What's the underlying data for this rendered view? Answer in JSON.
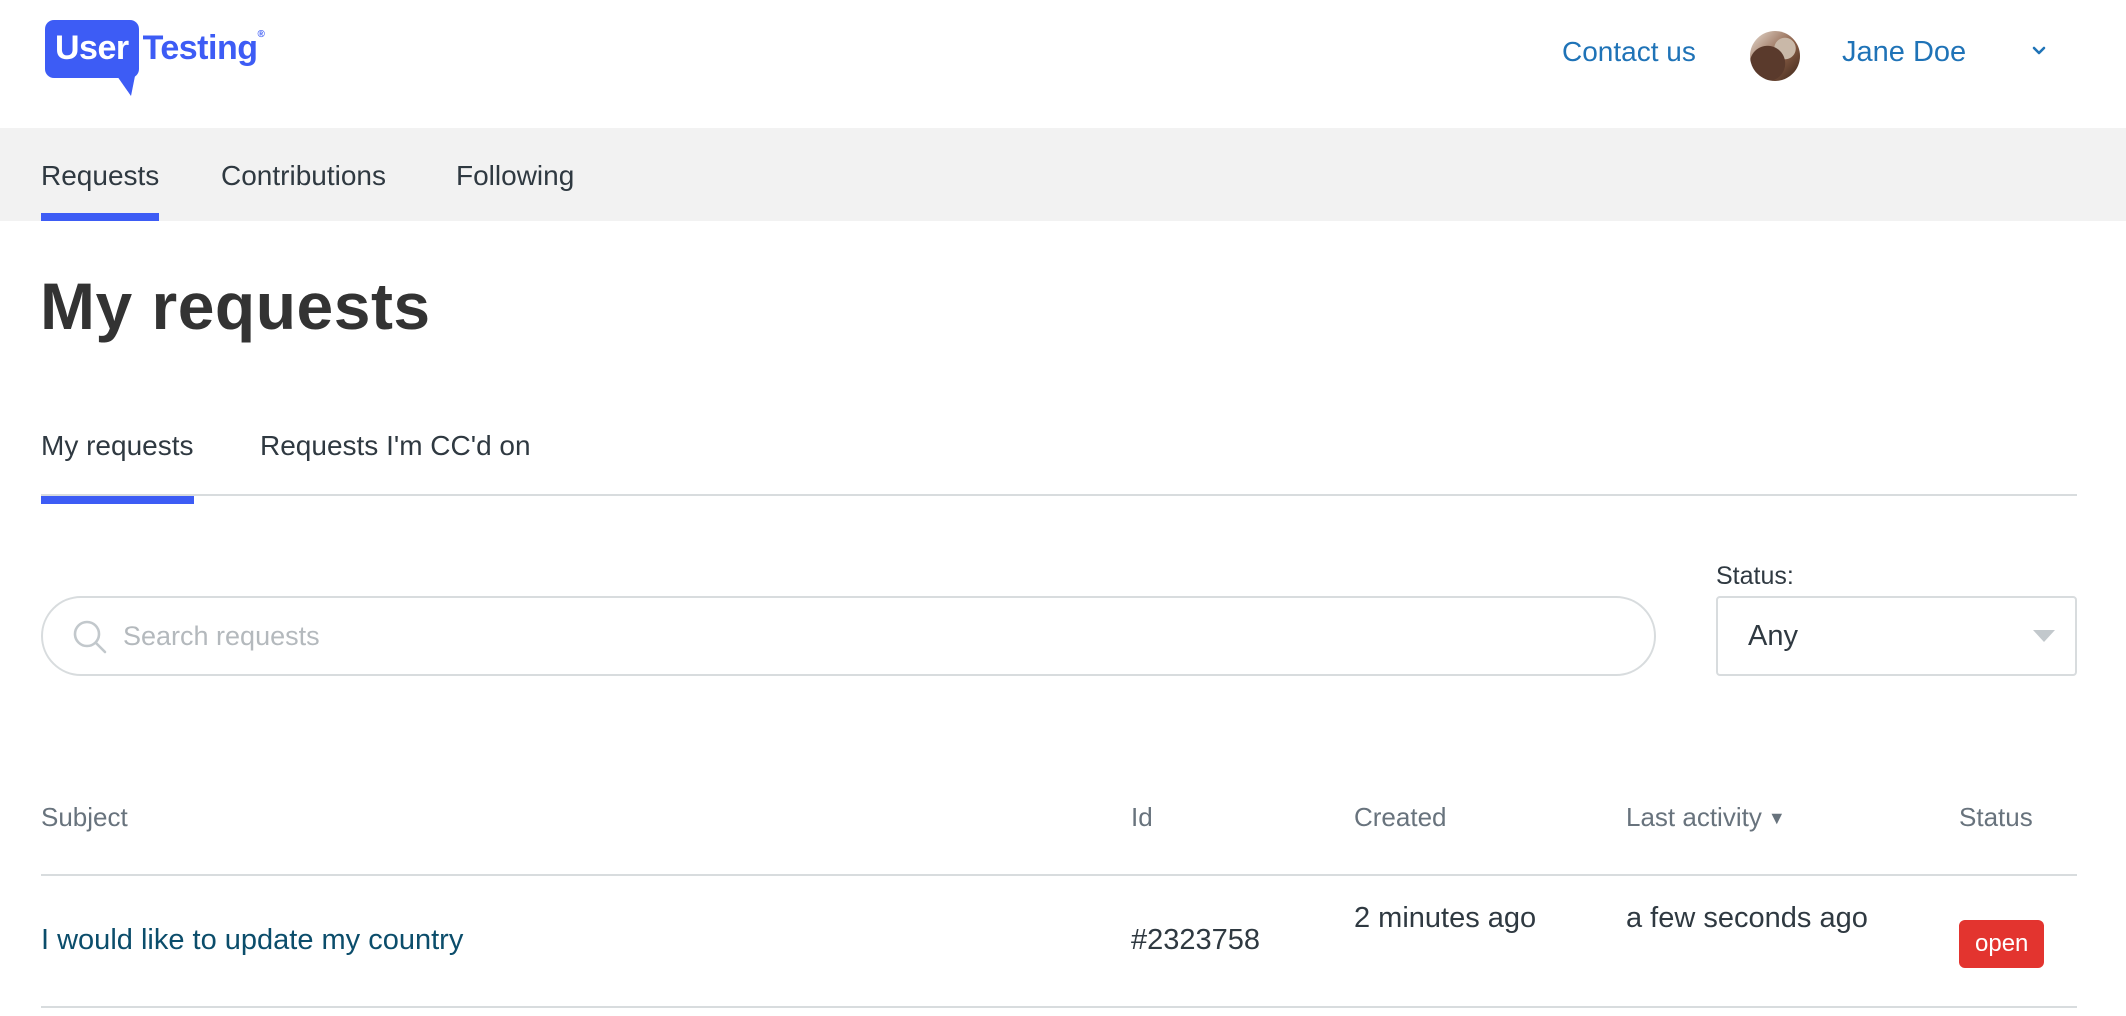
{
  "header": {
    "logo": {
      "part1": "User",
      "part2": "Testing",
      "mark": "®"
    },
    "contact_label": "Contact us",
    "user_name": "Jane Doe",
    "chevron_icon": "chevron-down-icon"
  },
  "nav": {
    "items": [
      {
        "label": "Requests",
        "active": true
      },
      {
        "label": "Contributions",
        "active": false
      },
      {
        "label": "Following",
        "active": false
      }
    ]
  },
  "page": {
    "title": "My requests"
  },
  "tabs": {
    "items": [
      {
        "label": "My requests",
        "active": true
      },
      {
        "label": "Requests I'm CC'd on",
        "active": false
      }
    ]
  },
  "search": {
    "placeholder": "Search requests",
    "value": "",
    "icon": "search-icon"
  },
  "filter": {
    "label": "Status:",
    "selected": "Any"
  },
  "table": {
    "headers": {
      "subject": "Subject",
      "id": "Id",
      "created": "Created",
      "last_activity": "Last activity",
      "sort_indicator": "▼",
      "status": "Status"
    },
    "rows": [
      {
        "subject": "I would like to update my country",
        "id": "#2323758",
        "created": "2 minutes ago",
        "last_activity": "a few seconds ago",
        "status": "open"
      }
    ]
  },
  "colors": {
    "accent": "#3d5cf5",
    "link": "#1f73b7",
    "badge_open": "#e3342f",
    "nav_background": "#f2f2f2"
  }
}
